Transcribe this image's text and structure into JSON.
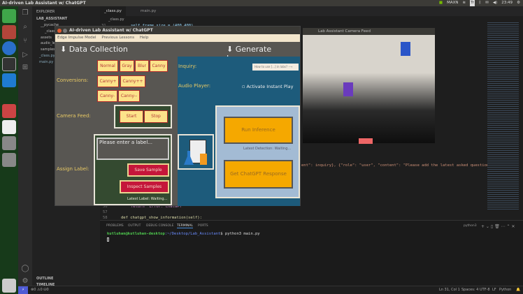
{
  "topbar": {
    "title": "AI-driven Lab Assistant w/ ChatGPT",
    "power_mode": "MAXN",
    "keyboard": "Tr",
    "clock": "23:49"
  },
  "vscode": {
    "explorer": {
      "title": "EXPLORER",
      "root": "LAB_ASSISTANT",
      "items": [
        "__pycache__",
        "_class.c...",
        "assets",
        "audio_les...",
        "samples",
        "_class.py",
        "main.py"
      ],
      "outline": "OUTLINE",
      "timeline": "TIMELINE"
    },
    "tabs": [
      "_class.py",
      "main.py"
    ],
    "breadcrumb": "_class.py",
    "code_lines": [
      {
        "num": "31",
        "text": "self.frame_size = (400,400)"
      },
      {
        "num": "56",
        "text": "return \"Error: ChatGPT\""
      },
      {
        "num": "57",
        "text": ""
      },
      {
        "num": "58",
        "text": "def chatgpt_show_information(self):"
      }
    ],
    "code_fragment": "ent\": inquiry}, {\"role\": \"user\", \"content\": \"Please add the latest asked question",
    "panel_tabs": [
      "PROBLEMS",
      "OUTPUT",
      "DEBUG CONSOLE",
      "TERMINAL",
      "PORTS"
    ],
    "terminal": {
      "prompt_user": "kutluhan@kutluhan-desktop",
      "prompt_path": ":~/Desktop/Lab_Assistant",
      "command": "$ python3 main.py",
      "shell": "python3"
    },
    "status": {
      "errors": "0",
      "warnings": "0",
      "ports": "0",
      "position": "Ln 31, Col 1",
      "spaces": "Spaces: 4",
      "encoding": "UTF-8",
      "eol": "LF",
      "language": "Python"
    }
  },
  "app": {
    "title": "AI-driven Lab Assistant w/ ChatGPT",
    "menu": [
      "Edge Impulse Model",
      "Previous Lessons",
      "Help"
    ],
    "data_collection": "⬇ Data Collection",
    "generate_lesson": "⬇ Generate Lesson",
    "conversions_label": "Conversions:",
    "conversions": [
      "Normal",
      "Gray",
      "Blur",
      "Canny",
      "Canny+",
      "Canny++",
      "Canny-",
      "Canny--"
    ],
    "camera_feed_label": "Camera Feed:",
    "start": "Start",
    "stop": "Stop",
    "assign_label": "Assign Label:",
    "label_placeholder": "Please enter a label...",
    "save_sample": "Save Sample",
    "inspect_samples": "Inspect Samples",
    "latest_label": "Latest Label: Waiting...",
    "inquiry_label": "Inquiry:",
    "inquiry_value": "How to use [...] in labs?",
    "audio_player_label": "Audio Player:",
    "instant_play": "Activate Instant Play",
    "run_inference": "Run Inference",
    "latest_detection": "Latest Detection: Waiting...",
    "chatgpt_response": "Get ChatGPT Response"
  },
  "camera_window": {
    "title": "Lab Assistant Camera Feed"
  }
}
